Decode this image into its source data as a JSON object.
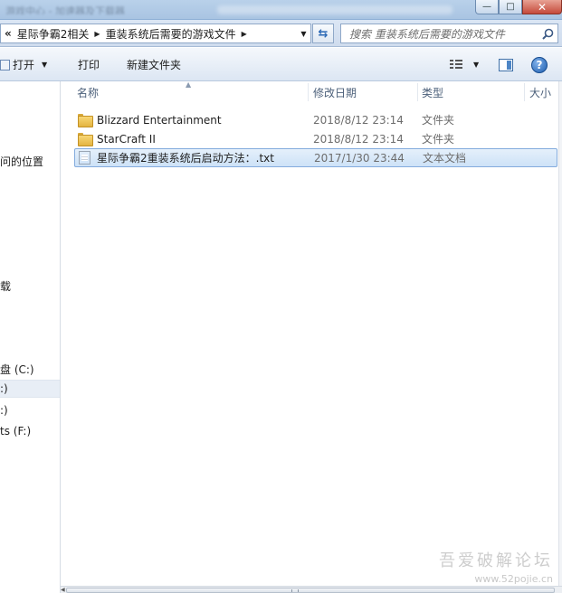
{
  "window": {
    "title_blurred": "游戏中心 - 加速器及下载器",
    "buttons": {
      "minimize": "—",
      "maximize": "□",
      "close": "✕"
    }
  },
  "address": {
    "back_chevron": "«",
    "breadcrumbs": [
      "星际争霸2相关",
      "重装系统后需要的游戏文件"
    ],
    "search_placeholder": "搜索 重装系统后需要的游戏文件"
  },
  "toolbar": {
    "open_label": "打开",
    "print_label": "打印",
    "new_folder_label": "新建文件夹"
  },
  "nav": {
    "items": [
      {
        "label": "问的位置"
      },
      {
        "label": "载"
      },
      {
        "label": "盘 (C:)"
      },
      {
        "label": ":)"
      },
      {
        "label": ":)"
      },
      {
        "label": "ts (F:)"
      }
    ]
  },
  "columns": {
    "name": "名称",
    "date": "修改日期",
    "type": "类型",
    "size": "大小"
  },
  "files": [
    {
      "name": "Blizzard Entertainment",
      "date": "2018/8/12 23:14",
      "type": "文件夹",
      "icon": "folder-icon"
    },
    {
      "name": "StarCraft II",
      "date": "2018/8/12 23:14",
      "type": "文件夹",
      "icon": "folder-icon"
    },
    {
      "name": "星际争霸2重装系统后启动方法：.txt",
      "date": "2017/1/30 23:44",
      "type": "文本文档",
      "icon": "text-file-icon",
      "selected": true
    }
  ],
  "watermark": {
    "title": "吾爱破解论坛",
    "url": "www.52pojie.cn"
  },
  "colors": {
    "selection": "#cde2f7",
    "toolbar_gradient_top": "#f5f8fc",
    "accent_blue": "#2a68b5"
  }
}
